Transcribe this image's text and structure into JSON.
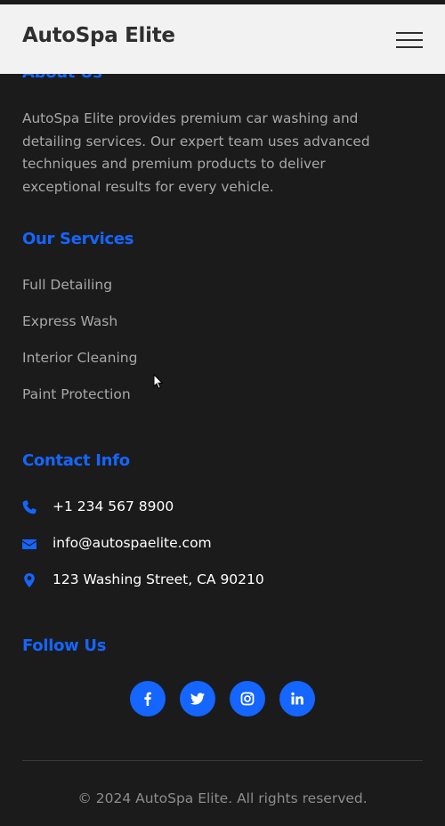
{
  "header": {
    "brand": "AutoSpa Elite",
    "menu_icon": "hamburger-menu-icon"
  },
  "about": {
    "title": "About Us",
    "text": "AutoSpa Elite provides premium car washing and detailing services. Our expert team uses advanced techniques and premium products to deliver exceptional results for every vehicle."
  },
  "services": {
    "title": "Our Services",
    "items": [
      "Full Detailing",
      "Express Wash",
      "Interior Cleaning",
      "Paint Protection"
    ]
  },
  "contact": {
    "title": "Contact Info",
    "items": [
      {
        "icon": "phone-icon",
        "text": "+1 234 567 8900"
      },
      {
        "icon": "envelope-icon",
        "text": "info@autospaelite.com"
      },
      {
        "icon": "map-pin-icon",
        "text": "123 Washing Street, CA 90210"
      }
    ]
  },
  "follow": {
    "title": "Follow Us",
    "links": [
      "facebook-icon",
      "twitter-icon",
      "instagram-icon",
      "linkedin-icon"
    ]
  },
  "footer": {
    "copyright": "© 2024 AutoSpa Elite. All rights reserved."
  },
  "colors": {
    "accent": "#1565ff",
    "background": "#1b1b1b",
    "header_bg": "#f2f2f2",
    "muted_text": "#a8a8a8"
  }
}
